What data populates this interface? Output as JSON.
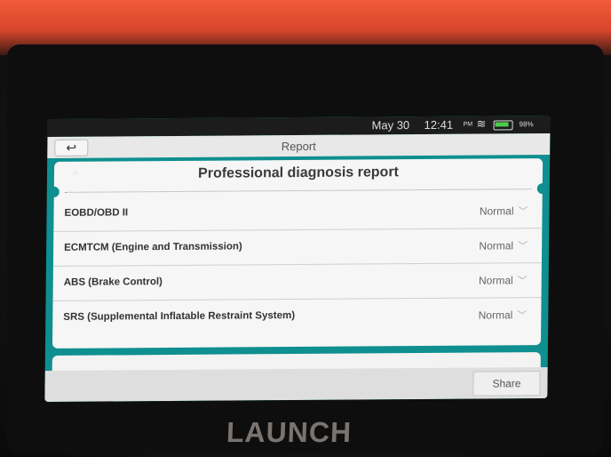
{
  "device": {
    "brand": "LAUNCH"
  },
  "status_bar": {
    "date": "May 30",
    "time": "12:41",
    "ampm": "PM",
    "battery": "98%"
  },
  "header": {
    "back_icon": "↩",
    "title": "Report"
  },
  "report": {
    "heading": "Professional diagnosis report",
    "items": [
      {
        "name": "EOBD/OBD II",
        "status": "Normal"
      },
      {
        "name": "ECMTCM (Engine and Transmission)",
        "status": "Normal"
      },
      {
        "name": "ABS (Brake Control)",
        "status": "Normal"
      },
      {
        "name": "SRS (Supplemental Inflatable Restraint System)",
        "status": "Normal"
      }
    ]
  },
  "footer": {
    "share_label": "Share"
  }
}
